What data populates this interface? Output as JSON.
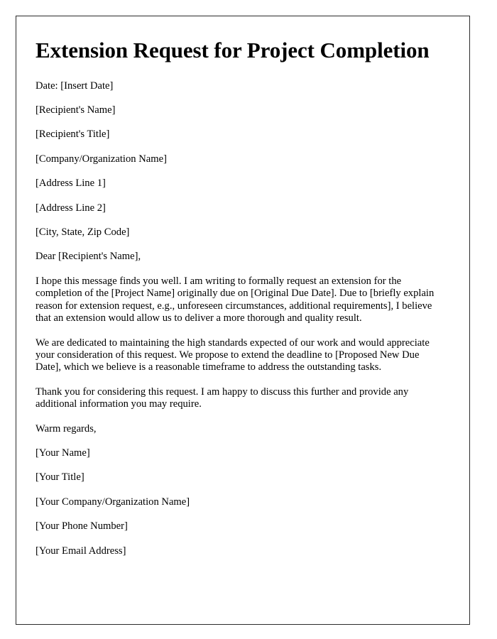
{
  "document": {
    "title": "Extension Request for Project Completion",
    "blocks": [
      {
        "id": "date-line",
        "name": "date-line",
        "text": "Date: [Insert Date]"
      },
      {
        "id": "recipient-name",
        "name": "recipient-name-line",
        "text": "[Recipient's Name]"
      },
      {
        "id": "recipient-title",
        "name": "recipient-title-line",
        "text": "[Recipient's Title]"
      },
      {
        "id": "company-name",
        "name": "company-organization-name-line",
        "text": "[Company/Organization Name]"
      },
      {
        "id": "address-line-1",
        "name": "address-line-1",
        "text": "[Address Line 1]"
      },
      {
        "id": "address-line-2",
        "name": "address-line-2",
        "text": "[Address Line 2]"
      },
      {
        "id": "city-state-zip",
        "name": "city-state-zip-line",
        "text": "[City, State, Zip Code]"
      },
      {
        "id": "salutation",
        "name": "salutation-line",
        "text": "Dear [Recipient's Name],"
      },
      {
        "id": "paragraph-1",
        "name": "body-paragraph-1",
        "text": "I hope this message finds you well. I am writing to formally request an extension for the completion of the [Project Name] originally due on [Original Due Date]. Due to [briefly explain reason for extension request, e.g., unforeseen circumstances, additional requirements], I believe that an extension would allow us to deliver a more thorough and quality result."
      },
      {
        "id": "paragraph-2",
        "name": "body-paragraph-2",
        "text": "We are dedicated to maintaining the high standards expected of our work and would appreciate your consideration of this request. We propose to extend the deadline to [Proposed New Due Date], which we believe is a reasonable timeframe to address the outstanding tasks."
      },
      {
        "id": "paragraph-3",
        "name": "body-paragraph-3",
        "text": "Thank you for considering this request. I am happy to discuss this further and provide any additional information you may require."
      },
      {
        "id": "closing",
        "name": "closing-line",
        "text": "Warm regards,"
      },
      {
        "id": "your-name",
        "name": "signature-your-name",
        "text": "[Your Name]"
      },
      {
        "id": "your-title",
        "name": "signature-your-title",
        "text": "[Your Title]"
      },
      {
        "id": "your-company",
        "name": "signature-your-company",
        "text": "[Your Company/Organization Name]"
      },
      {
        "id": "your-phone",
        "name": "signature-your-phone",
        "text": "[Your Phone Number]"
      },
      {
        "id": "your-email",
        "name": "signature-your-email",
        "text": "[Your Email Address]"
      }
    ]
  },
  "style": {
    "border_color": "#2b2b2b",
    "text_color": "#000000",
    "page_background": "#ffffff"
  }
}
